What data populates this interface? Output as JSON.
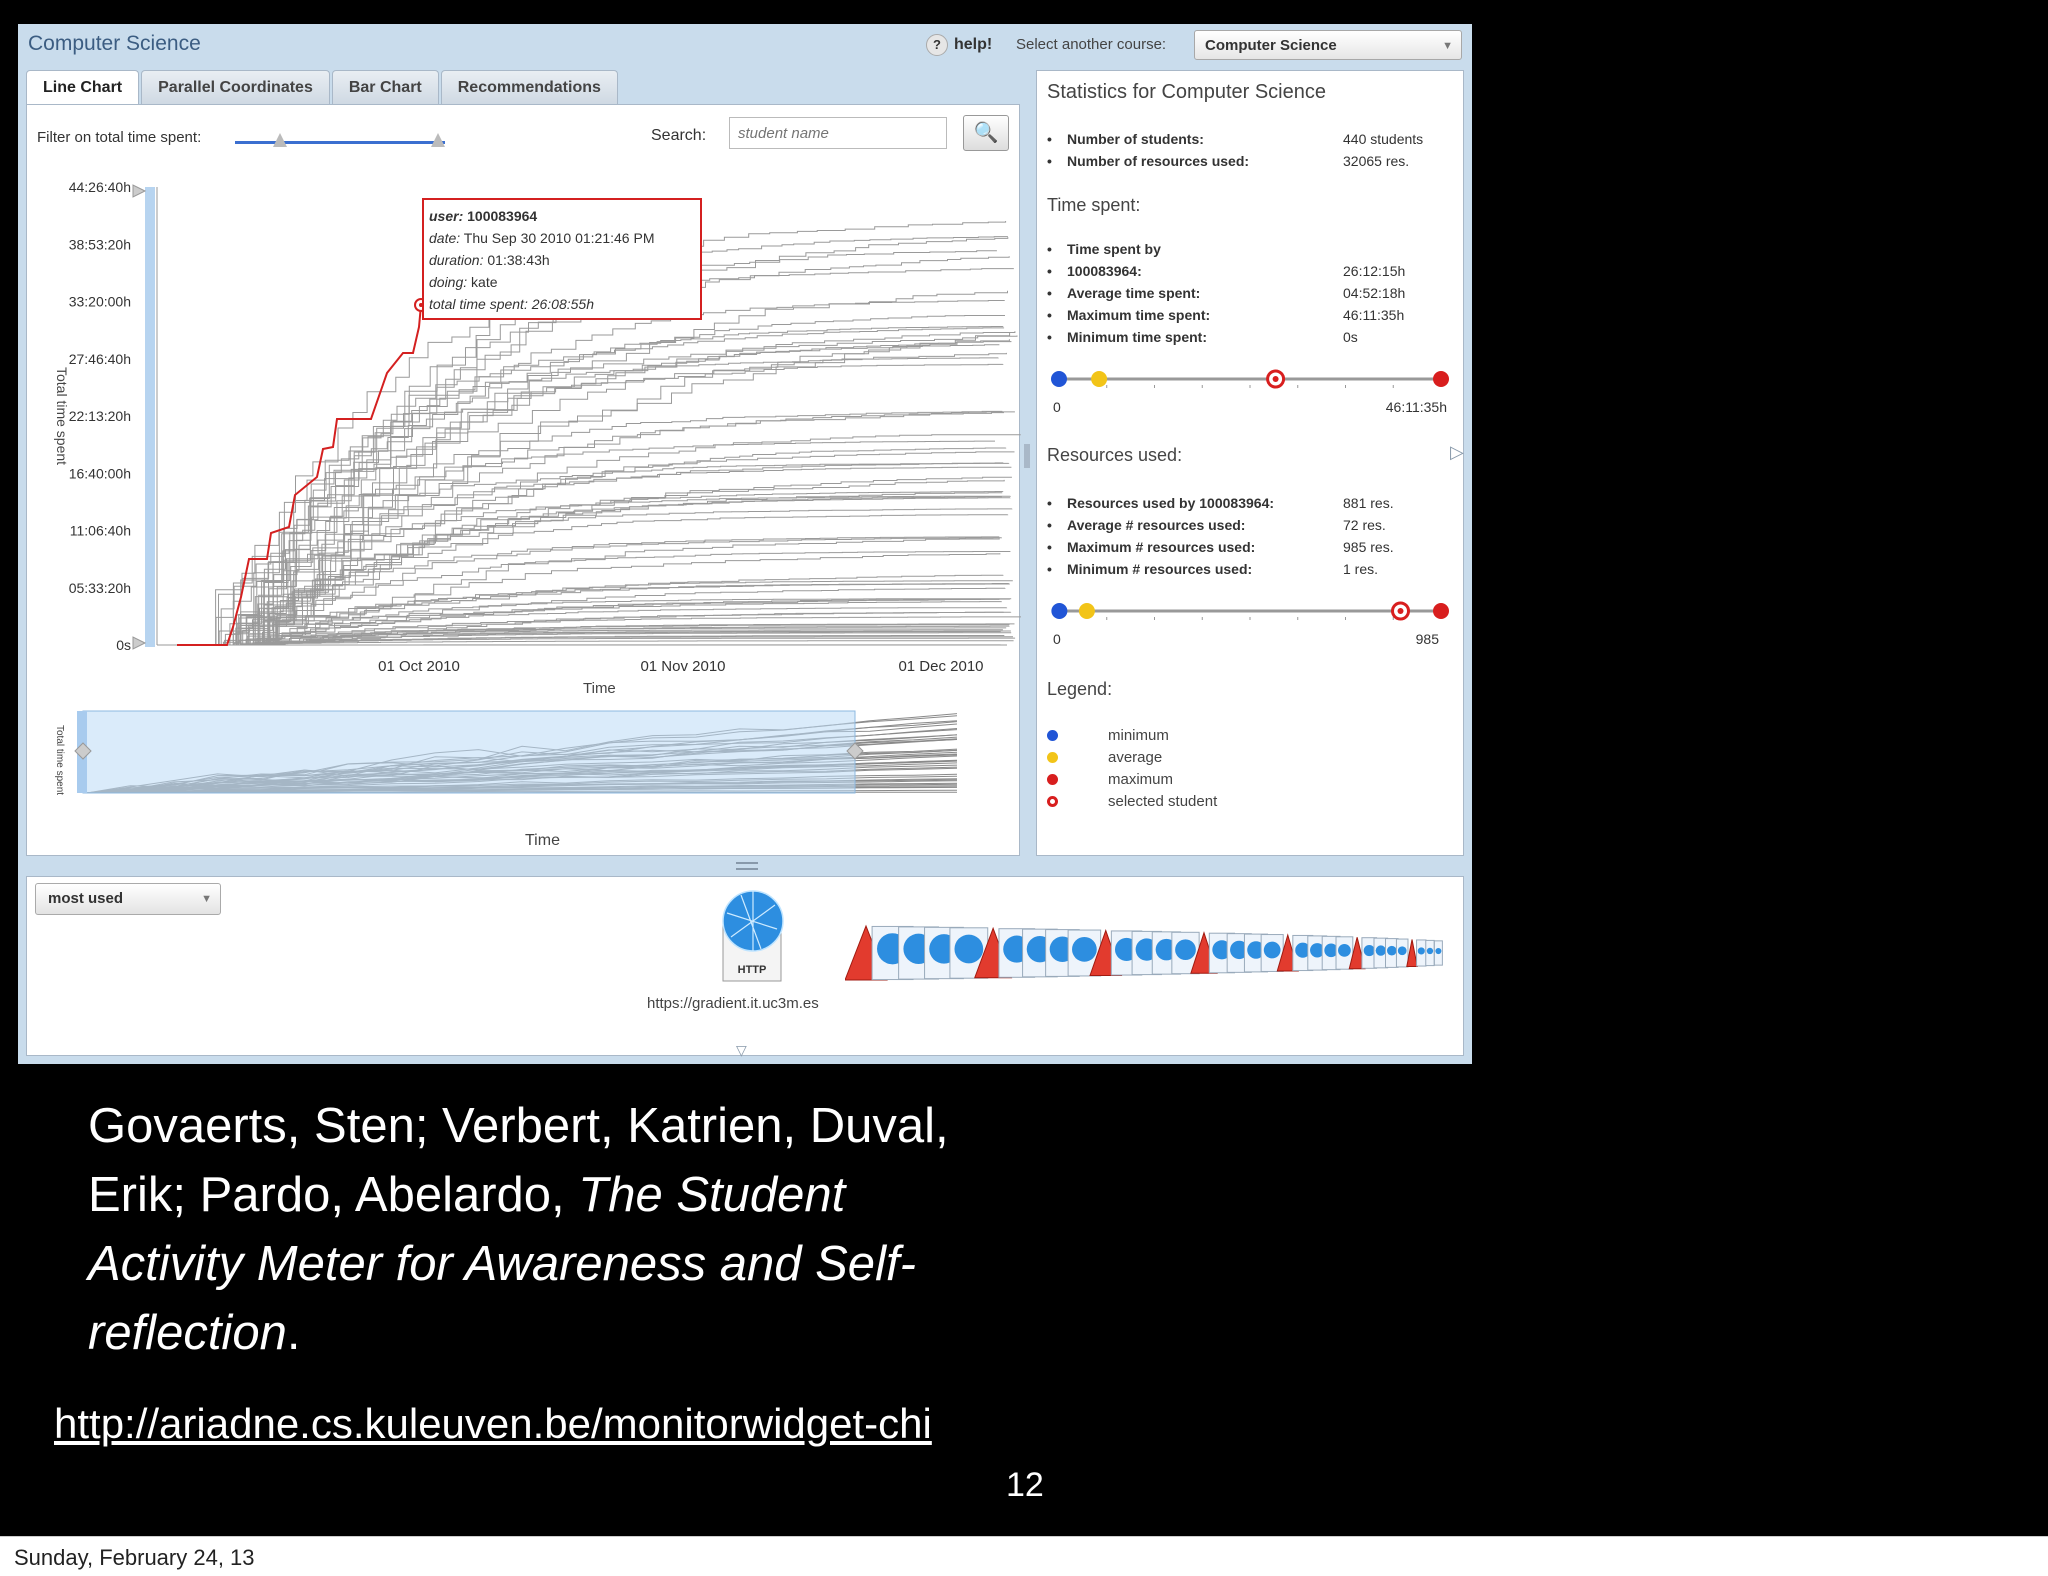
{
  "app": {
    "title": "Computer Science",
    "help_label": "help!",
    "help_icon": "?",
    "course_label": "Select another course:",
    "course_selected": "Computer Science"
  },
  "tabs": [
    {
      "label": "Line Chart",
      "active": true
    },
    {
      "label": "Parallel Coordinates",
      "active": false
    },
    {
      "label": "Bar Chart",
      "active": false
    },
    {
      "label": "Recommendations",
      "active": false
    }
  ],
  "filter": {
    "label": "Filter on total time spent:"
  },
  "search": {
    "label": "Search:",
    "placeholder": "student name"
  },
  "chart_data": {
    "type": "line",
    "ylabel": "Total time spent",
    "xlabel": "Time",
    "yticks": [
      "44:26:40h",
      "38:53:20h",
      "33:20:00h",
      "27:46:40h",
      "22:13:20h",
      "16:40:00h",
      "11:06:40h",
      "05:33:20h",
      "0s"
    ],
    "xticks": [
      "01 Oct 2010",
      "01 Nov 2010",
      "01 Dec 2010"
    ],
    "selected_color": "#d42020",
    "series_color": "#9a9a9a",
    "tooltip": {
      "user_label": "user:",
      "user": "100083964",
      "date_label": "date:",
      "date": "Thu Sep 30 2010 01:21:46 PM",
      "duration_label": "duration:",
      "duration": "01:38:43h",
      "doing_label": "doing:",
      "doing": "kate",
      "total_label": "total time spent:",
      "total": "26:08:55h"
    },
    "mini": {
      "ylabel": "Total time spent",
      "xlabel": "Time"
    }
  },
  "stats": {
    "title": "Statistics for Computer Science",
    "general": [
      {
        "label": "Number of students:",
        "value": "440 students"
      },
      {
        "label": "Number of resources used:",
        "value": "32065 res."
      }
    ],
    "time_title": "Time spent:",
    "time": [
      {
        "label": "Time spent by",
        "label2": "100083964:",
        "value": "26:12:15h"
      },
      {
        "label": "Average time spent:",
        "value": "04:52:18h"
      },
      {
        "label": "Maximum time spent:",
        "value": "46:11:35h"
      },
      {
        "label": "Minimum time spent:",
        "value": "0s"
      }
    ],
    "time_scale": {
      "min_label": "0",
      "max_label": "46:11:35h",
      "min": 0,
      "avg": 0.105,
      "selected": 0.567,
      "max": 1
    },
    "res_title": "Resources used:",
    "resources": [
      {
        "label": "Resources used by 100083964:",
        "value": "881 res."
      },
      {
        "label": "Average # resources used:",
        "value": "72 res."
      },
      {
        "label": "Maximum # resources used:",
        "value": "985 res."
      },
      {
        "label": "Minimum # resources used:",
        "value": "1 res."
      }
    ],
    "res_scale": {
      "min_label": "0",
      "max_label": "985",
      "min": 0.001,
      "avg": 0.073,
      "selected": 0.894,
      "max": 1
    },
    "legend_title": "Legend:",
    "legend": [
      {
        "label": "minimum",
        "color": "#2155d6"
      },
      {
        "label": "average",
        "color": "#f2c418"
      },
      {
        "label": "maximum",
        "color": "#d81e1e"
      },
      {
        "label": "selected student",
        "color": "#d81e1e"
      }
    ]
  },
  "bottom": {
    "sort_selected": "most used",
    "resource_label": "HTTP",
    "resource_url": "https://gradient.it.uc3m.es"
  },
  "caption": {
    "authors": "Govaerts, Sten; Verbert, Katrien, Duval, Erik; Pardo, Abelardo,",
    "title": "The Student Activity Meter for Awareness and Self-reflection",
    "end": ".",
    "link": "http://ariadne.cs.kuleuven.be/monitorwidget-chi",
    "page": "12"
  },
  "footer": {
    "date": "Sunday, February 24, 13"
  }
}
